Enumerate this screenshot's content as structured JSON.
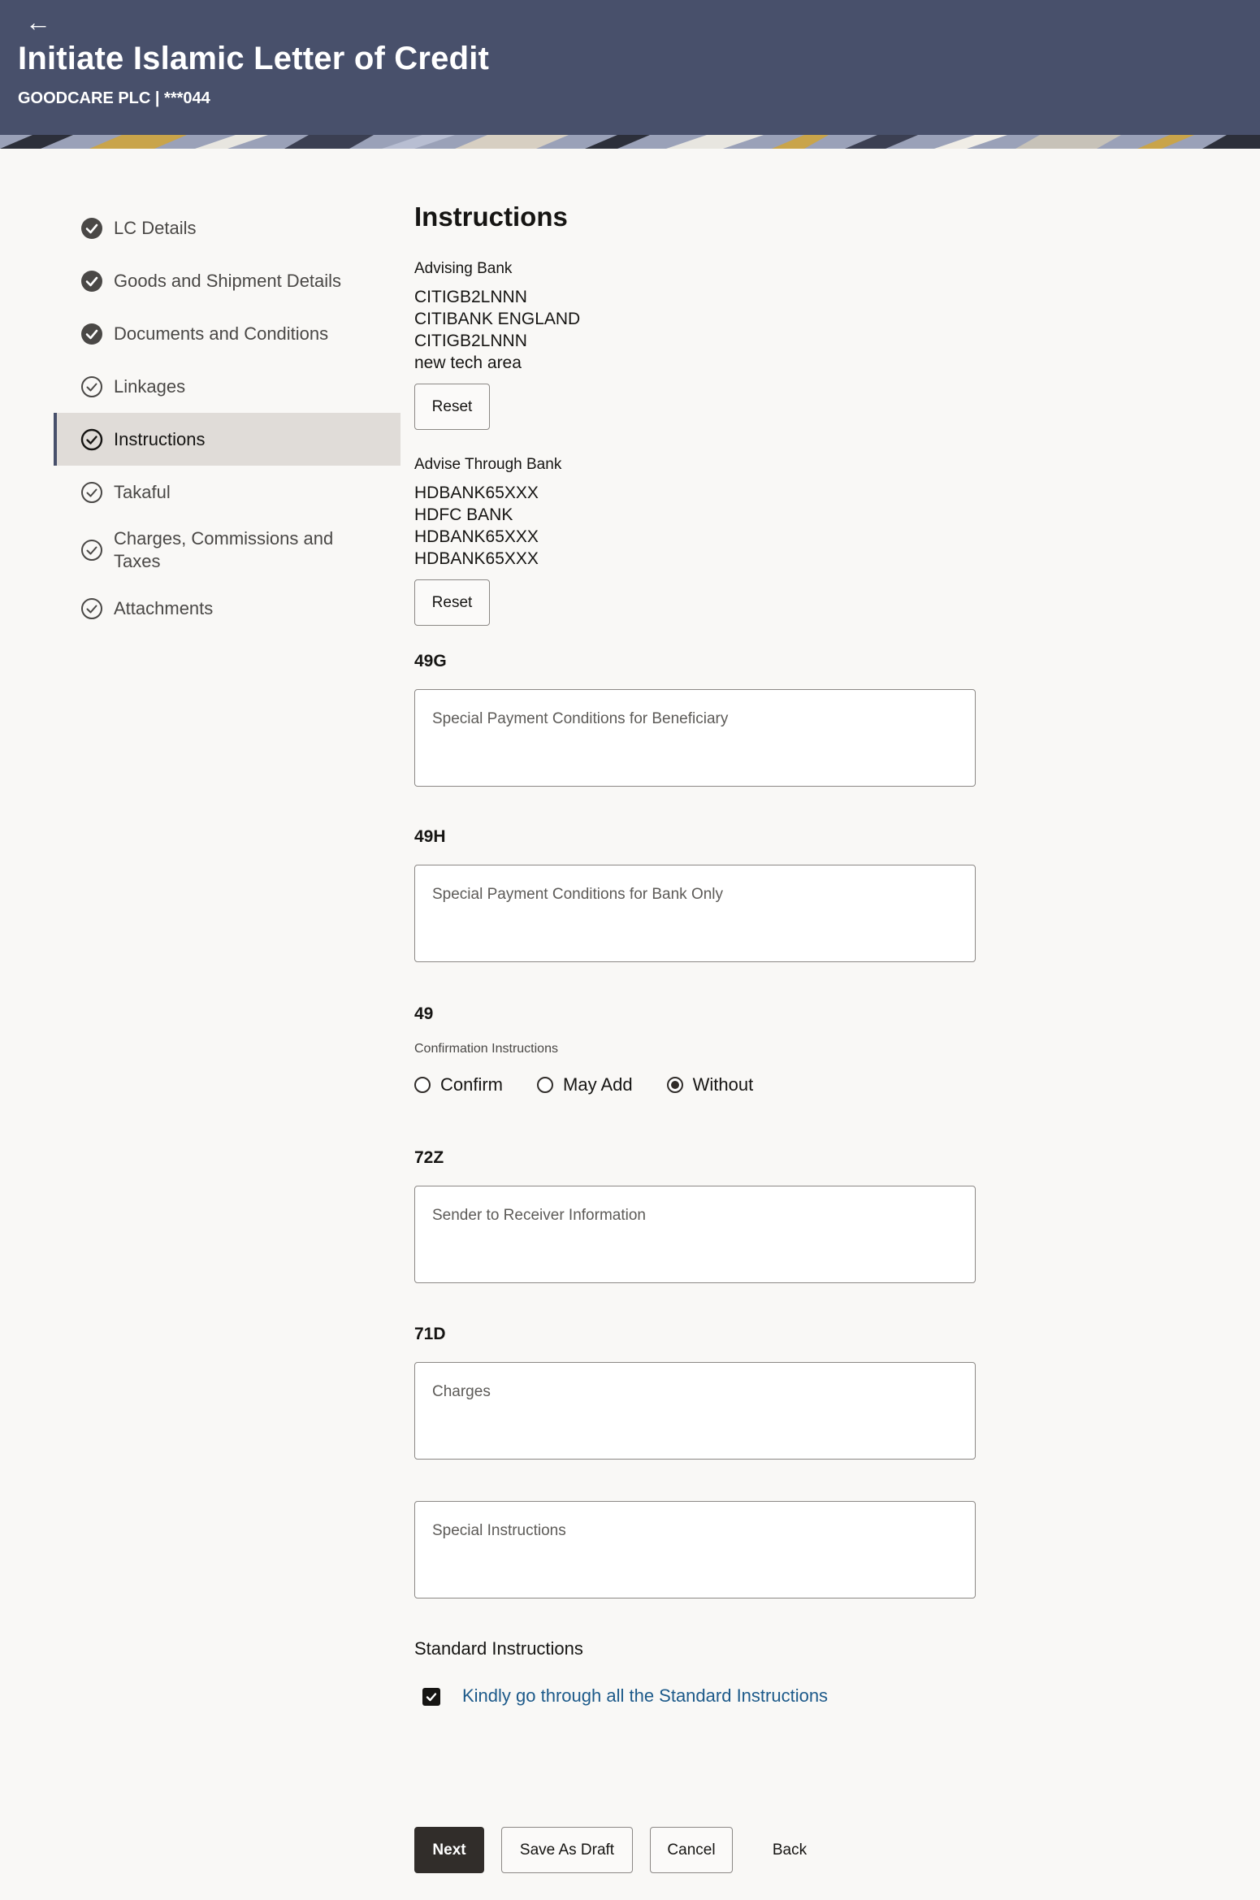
{
  "header": {
    "title": "Initiate Islamic Letter of Credit",
    "subtitle": "GOODCARE PLC | ***044",
    "back_icon": "arrow-left-icon"
  },
  "sidebar": {
    "items": [
      {
        "label": "LC Details",
        "state": "completed"
      },
      {
        "label": "Goods and Shipment Details",
        "state": "completed"
      },
      {
        "label": "Documents and Conditions",
        "state": "completed"
      },
      {
        "label": "Linkages",
        "state": "pending"
      },
      {
        "label": "Instructions",
        "state": "active"
      },
      {
        "label": "Takaful",
        "state": "pending"
      },
      {
        "label": "Charges, Commissions and Taxes",
        "state": "pending"
      },
      {
        "label": "Attachments",
        "state": "pending"
      }
    ]
  },
  "main": {
    "section_title": "Instructions",
    "advising_bank": {
      "label": "Advising Bank",
      "lines": [
        "CITIGB2LNNN",
        "CITIBANK ENGLAND",
        "CITIGB2LNNN",
        "new tech area"
      ],
      "reset_label": "Reset"
    },
    "advise_through_bank": {
      "label": "Advise Through Bank",
      "lines": [
        "HDBANK65XXX",
        "HDFC BANK",
        "HDBANK65XXX",
        "HDBANK65XXX"
      ],
      "reset_label": "Reset"
    },
    "field_49g": {
      "tag": "49G",
      "placeholder": "Special Payment Conditions for Beneficiary",
      "value": ""
    },
    "field_49h": {
      "tag": "49H",
      "placeholder": "Special Payment Conditions for Bank Only",
      "value": ""
    },
    "field_49": {
      "tag": "49",
      "label": "Confirmation Instructions",
      "options": [
        "Confirm",
        "May Add",
        "Without"
      ],
      "selected": "Without"
    },
    "field_72z": {
      "tag": "72Z",
      "placeholder": "Sender to Receiver Information",
      "value": ""
    },
    "field_71d": {
      "tag": "71D",
      "placeholder": "Charges",
      "value": ""
    },
    "special_instructions": {
      "placeholder": "Special Instructions",
      "value": ""
    },
    "standard_instructions": {
      "label": "Standard Instructions",
      "checked": true,
      "link_text": "Kindly go through all the Standard Instructions"
    },
    "actions": {
      "next": "Next",
      "save_draft": "Save As Draft",
      "cancel": "Cancel",
      "back": "Back"
    }
  },
  "colors": {
    "header_bg": "#48506b",
    "primary_button": "#312d2a",
    "link": "#1d5a8a",
    "active_nav_bg": "#e0dcd8"
  }
}
